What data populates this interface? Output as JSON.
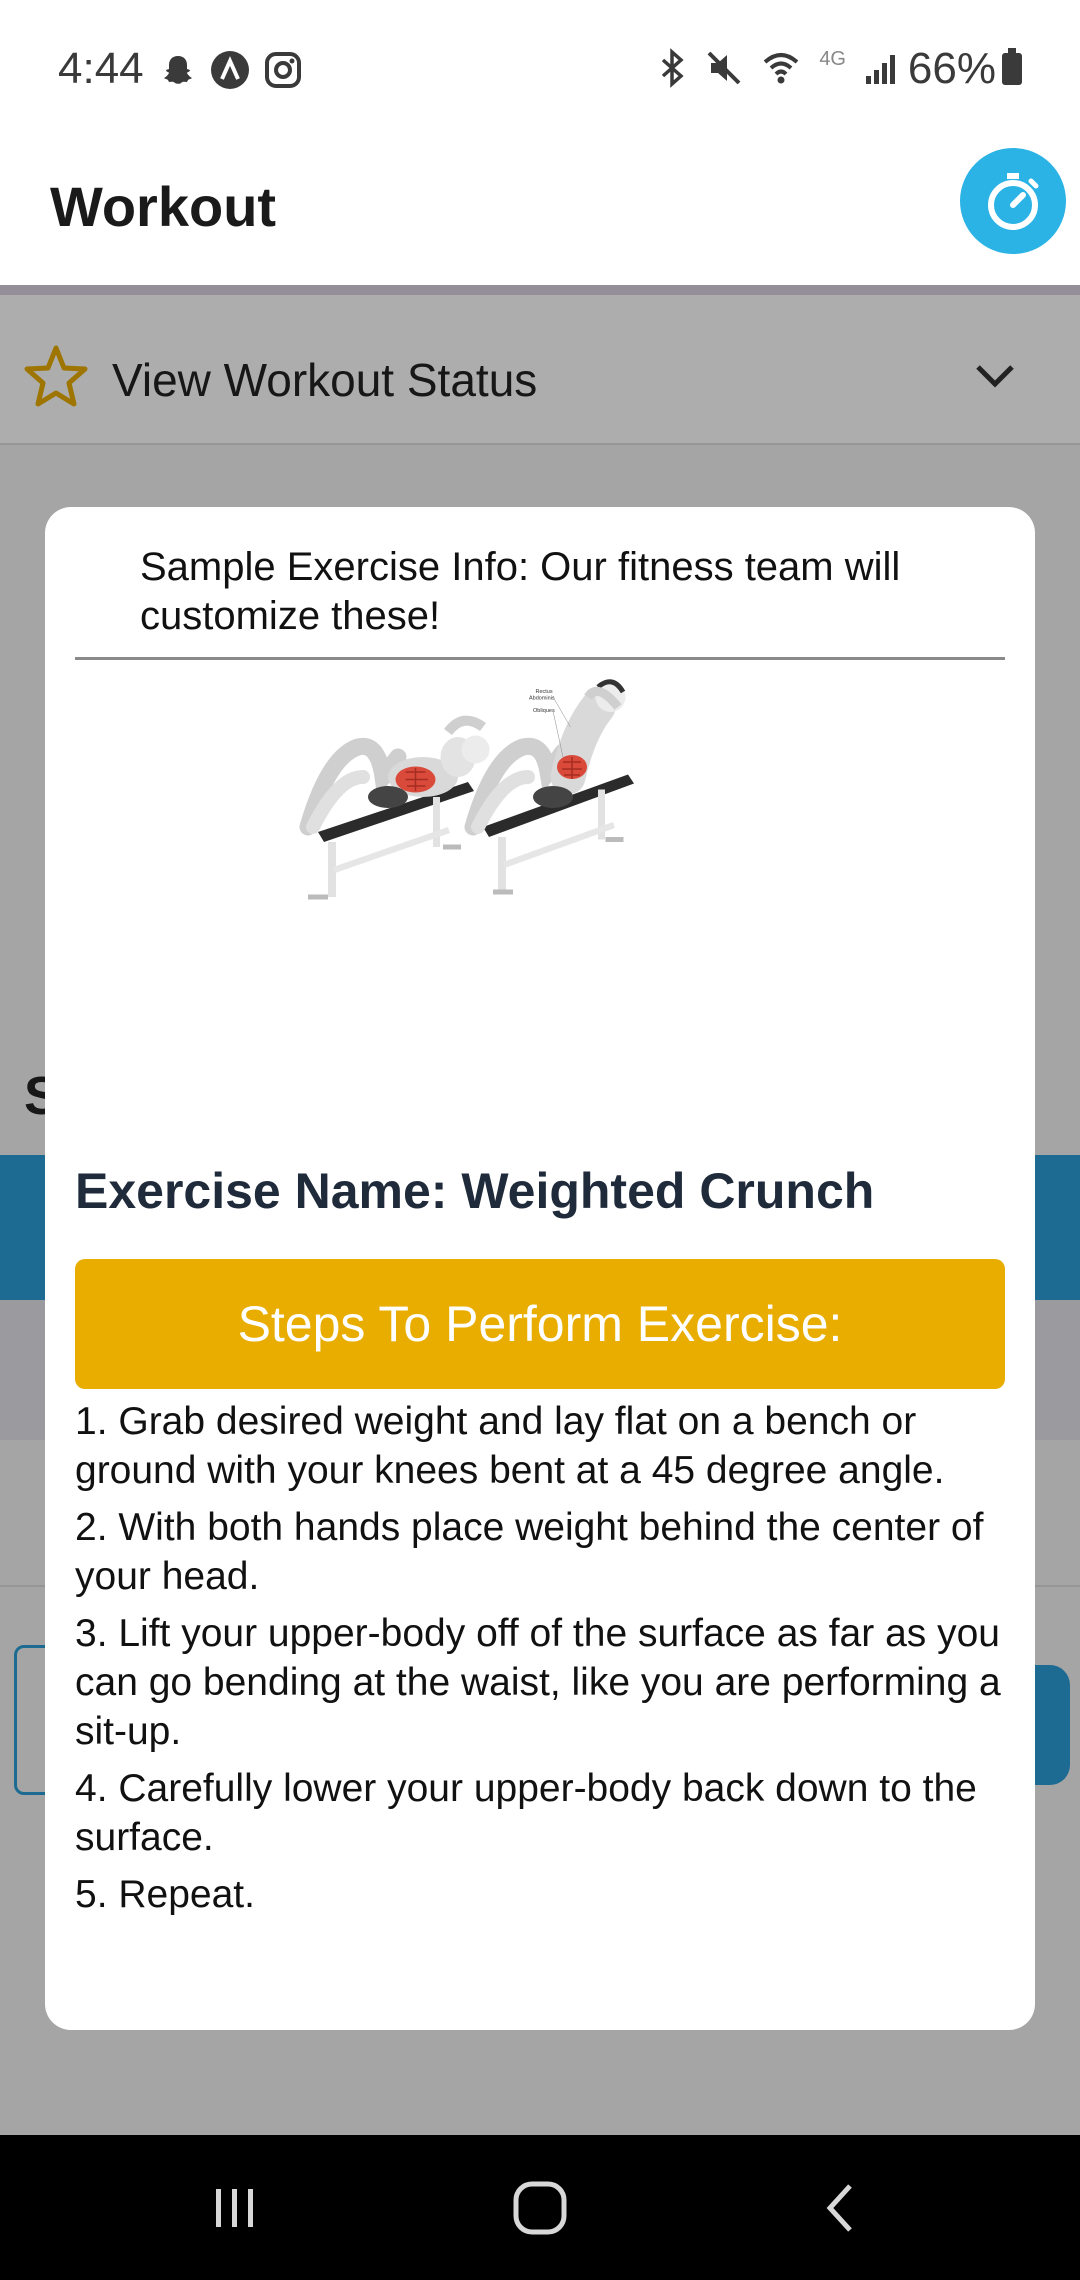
{
  "status_bar": {
    "time": "4:44",
    "battery": "66%",
    "network": "4G",
    "icons_left": [
      "snapchat-icon",
      "app-a-icon",
      "instagram-icon"
    ],
    "icons_right": [
      "bluetooth-icon",
      "mute-icon",
      "wifi-icon",
      "signal-icon",
      "battery-icon"
    ]
  },
  "header": {
    "title": "Workout",
    "timer_icon": "stopwatch-icon",
    "accent_color": "#2bb3e6"
  },
  "background": {
    "accordion_label": "View Workout Status",
    "accordion_icon": "star-outline-icon",
    "partial_letter": "S"
  },
  "modal": {
    "header_text": "Sample Exercise Info: Our fitness team will customize these!",
    "image_labels": {
      "rectus": "Rectus",
      "abdominis": "Abdominis",
      "obliques": "Obliques"
    },
    "exercise_name": "Exercise Name: Weighted Crunch",
    "steps_button_label": "Steps To Perform Exercise:",
    "steps_button_color": "#e9ad00",
    "steps": [
      "1. Grab desired weight and lay flat on a bench or ground with your knees bent at a 45 degree angle.",
      "2. With both hands place weight behind the center of your head.",
      "3. Lift your upper-body off of the surface as far as you can go bending at the waist, like you are performing a sit-up.",
      "4. Carefully lower your upper-body back down to the surface.",
      "5. Repeat."
    ]
  },
  "nav_bar": {
    "items": [
      "recent-apps-icon",
      "home-icon",
      "back-icon"
    ]
  }
}
